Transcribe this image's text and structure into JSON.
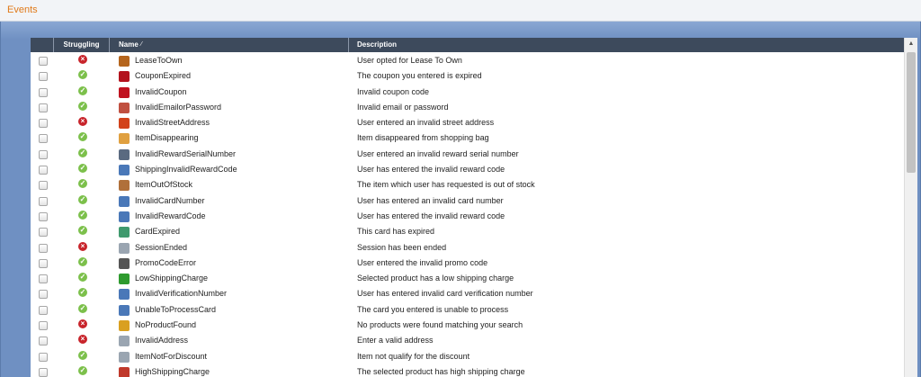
{
  "window": {
    "title": "Events"
  },
  "table": {
    "columns": {
      "struggling": "Struggling",
      "name": "Name",
      "description": "Description"
    },
    "name_sort_icon": "sort-indicator",
    "rows": [
      {
        "status": "bad",
        "icon": "receipt-icon",
        "icon_color": "#b5651d",
        "name": "LeaseToOwn",
        "description": "User opted for Lease To Own"
      },
      {
        "status": "ok",
        "icon": "price-tag-icon",
        "icon_color": "#b3121d",
        "name": "CouponExpired",
        "description": "The coupon you entered is expired"
      },
      {
        "status": "ok",
        "icon": "price-tag-icon",
        "icon_color": "#c0121f",
        "name": "InvalidCoupon",
        "description": "Invalid coupon code"
      },
      {
        "status": "ok",
        "icon": "lock-icon",
        "icon_color": "#c05040",
        "name": "InvalidEmailorPassword",
        "description": "Invalid email or password"
      },
      {
        "status": "bad",
        "icon": "airplane-icon",
        "icon_color": "#d2421a",
        "name": "InvalidStreetAddress",
        "description": "User entered an invalid street address"
      },
      {
        "status": "ok",
        "icon": "grid-box-icon",
        "icon_color": "#e0a040",
        "name": "ItemDisappearing",
        "description": "Item disappeared from shopping bag"
      },
      {
        "status": "ok",
        "icon": "card-reader-icon",
        "icon_color": "#5a6a80",
        "name": "InvalidRewardSerialNumber",
        "description": "User entered an invalid reward serial number"
      },
      {
        "status": "ok",
        "icon": "ship-icon",
        "icon_color": "#4a78b8",
        "name": "ShippingInvalidRewardCode",
        "description": "User has entered the invalid reward code"
      },
      {
        "status": "ok",
        "icon": "box-icon",
        "icon_color": "#b0703a",
        "name": "ItemOutOfStock",
        "description": "The item which user has requested is out of stock"
      },
      {
        "status": "ok",
        "icon": "card-error-icon",
        "icon_color": "#4a78b8",
        "name": "InvalidCardNumber",
        "description": "User has entered an invalid card number"
      },
      {
        "status": "ok",
        "icon": "reward-error-icon",
        "icon_color": "#4a78b8",
        "name": "InvalidRewardCode",
        "description": "User has entered the invalid reward code"
      },
      {
        "status": "ok",
        "icon": "card-expired-icon",
        "icon_color": "#3f9a6e",
        "name": "CardExpired",
        "description": "This card has expired"
      },
      {
        "status": "bad",
        "icon": "window-icon",
        "icon_color": "#9aa5b1",
        "name": "SessionEnded",
        "description": "Session has been ended"
      },
      {
        "status": "ok",
        "icon": "tag-icon",
        "icon_color": "#555555",
        "name": "PromoCodeError",
        "description": "User entered the invalid promo code"
      },
      {
        "status": "ok",
        "icon": "truck-icon",
        "icon_color": "#2e9a2e",
        "name": "LowShippingCharge",
        "description": "Selected product has a low shipping charge"
      },
      {
        "status": "ok",
        "icon": "card-error-icon",
        "icon_color": "#4a78b8",
        "name": "InvalidVerificationNumber",
        "description": "User has entered invalid card verification number"
      },
      {
        "status": "ok",
        "icon": "process-error-icon",
        "icon_color": "#4a78b8",
        "name": "UnableToProcessCard",
        "description": "The card you entered is unable to process"
      },
      {
        "status": "bad",
        "icon": "starburst-icon",
        "icon_color": "#d9a020",
        "name": "NoProductFound",
        "description": "No products were found matching your search"
      },
      {
        "status": "bad",
        "icon": "window-icon",
        "icon_color": "#9aa5b1",
        "name": "InvalidAddress",
        "description": "Enter a valid address"
      },
      {
        "status": "ok",
        "icon": "window-icon",
        "icon_color": "#9aa5b1",
        "name": "ItemNotForDiscount",
        "description": "Item not qualify for the discount"
      },
      {
        "status": "ok",
        "icon": "shipping-icon",
        "icon_color": "#c0392b",
        "name": "HighShippingCharge",
        "description": "The selected product has high shipping charge"
      }
    ]
  }
}
